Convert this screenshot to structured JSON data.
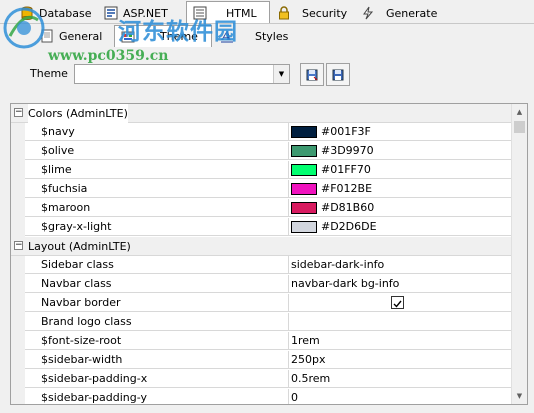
{
  "tabs_top": [
    {
      "label": "Database",
      "icon": "database-icon"
    },
    {
      "label": "ASP.NET",
      "icon": "aspnet-icon"
    },
    {
      "label": "HTML",
      "icon": "html-icon",
      "active": true
    },
    {
      "label": "Security",
      "icon": "lock-icon"
    },
    {
      "label": "Generate",
      "icon": "lightning-icon"
    }
  ],
  "tabs_sub": [
    {
      "label": "General",
      "icon": "page-icon"
    },
    {
      "label": "Theme",
      "icon": "palette-icon",
      "active": true
    },
    {
      "label": "Styles",
      "icon": "font-style-icon"
    }
  ],
  "watermark": {
    "cn": "河东软件园",
    "url": "www.pc0359.cn"
  },
  "theme": {
    "label": "Theme",
    "value": "",
    "buttons": [
      "load-theme-icon",
      "save-theme-icon"
    ]
  },
  "grid": {
    "categories": [
      {
        "label": "Colors (AdminLTE)",
        "expanded": true,
        "rows": [
          {
            "name": "$navy",
            "value": "#001F3F",
            "color": "#001F3F"
          },
          {
            "name": "$olive",
            "value": "#3D9970",
            "color": "#3D9970"
          },
          {
            "name": "$lime",
            "value": "#01FF70",
            "color": "#01FF70"
          },
          {
            "name": "$fuchsia",
            "value": "#F012BE",
            "color": "#F012BE"
          },
          {
            "name": "$maroon",
            "value": "#D81B60",
            "color": "#D81B60"
          },
          {
            "name": "$gray-x-light",
            "value": "#D2D6DE",
            "color": "#D2D6DE"
          }
        ]
      },
      {
        "label": "Layout (AdminLTE)",
        "expanded": true,
        "rows": [
          {
            "name": "Sidebar class",
            "value": "sidebar-dark-info"
          },
          {
            "name": "Navbar class",
            "value": "navbar-dark bg-info"
          },
          {
            "name": "Navbar border",
            "checked": true
          },
          {
            "name": "Brand logo class",
            "value": ""
          },
          {
            "name": "$font-size-root",
            "value": "1rem"
          },
          {
            "name": "$sidebar-width",
            "value": "250px"
          },
          {
            "name": "$sidebar-padding-x",
            "value": "0.5rem"
          },
          {
            "name": "$sidebar-padding-y",
            "value": "0"
          }
        ]
      }
    ]
  }
}
